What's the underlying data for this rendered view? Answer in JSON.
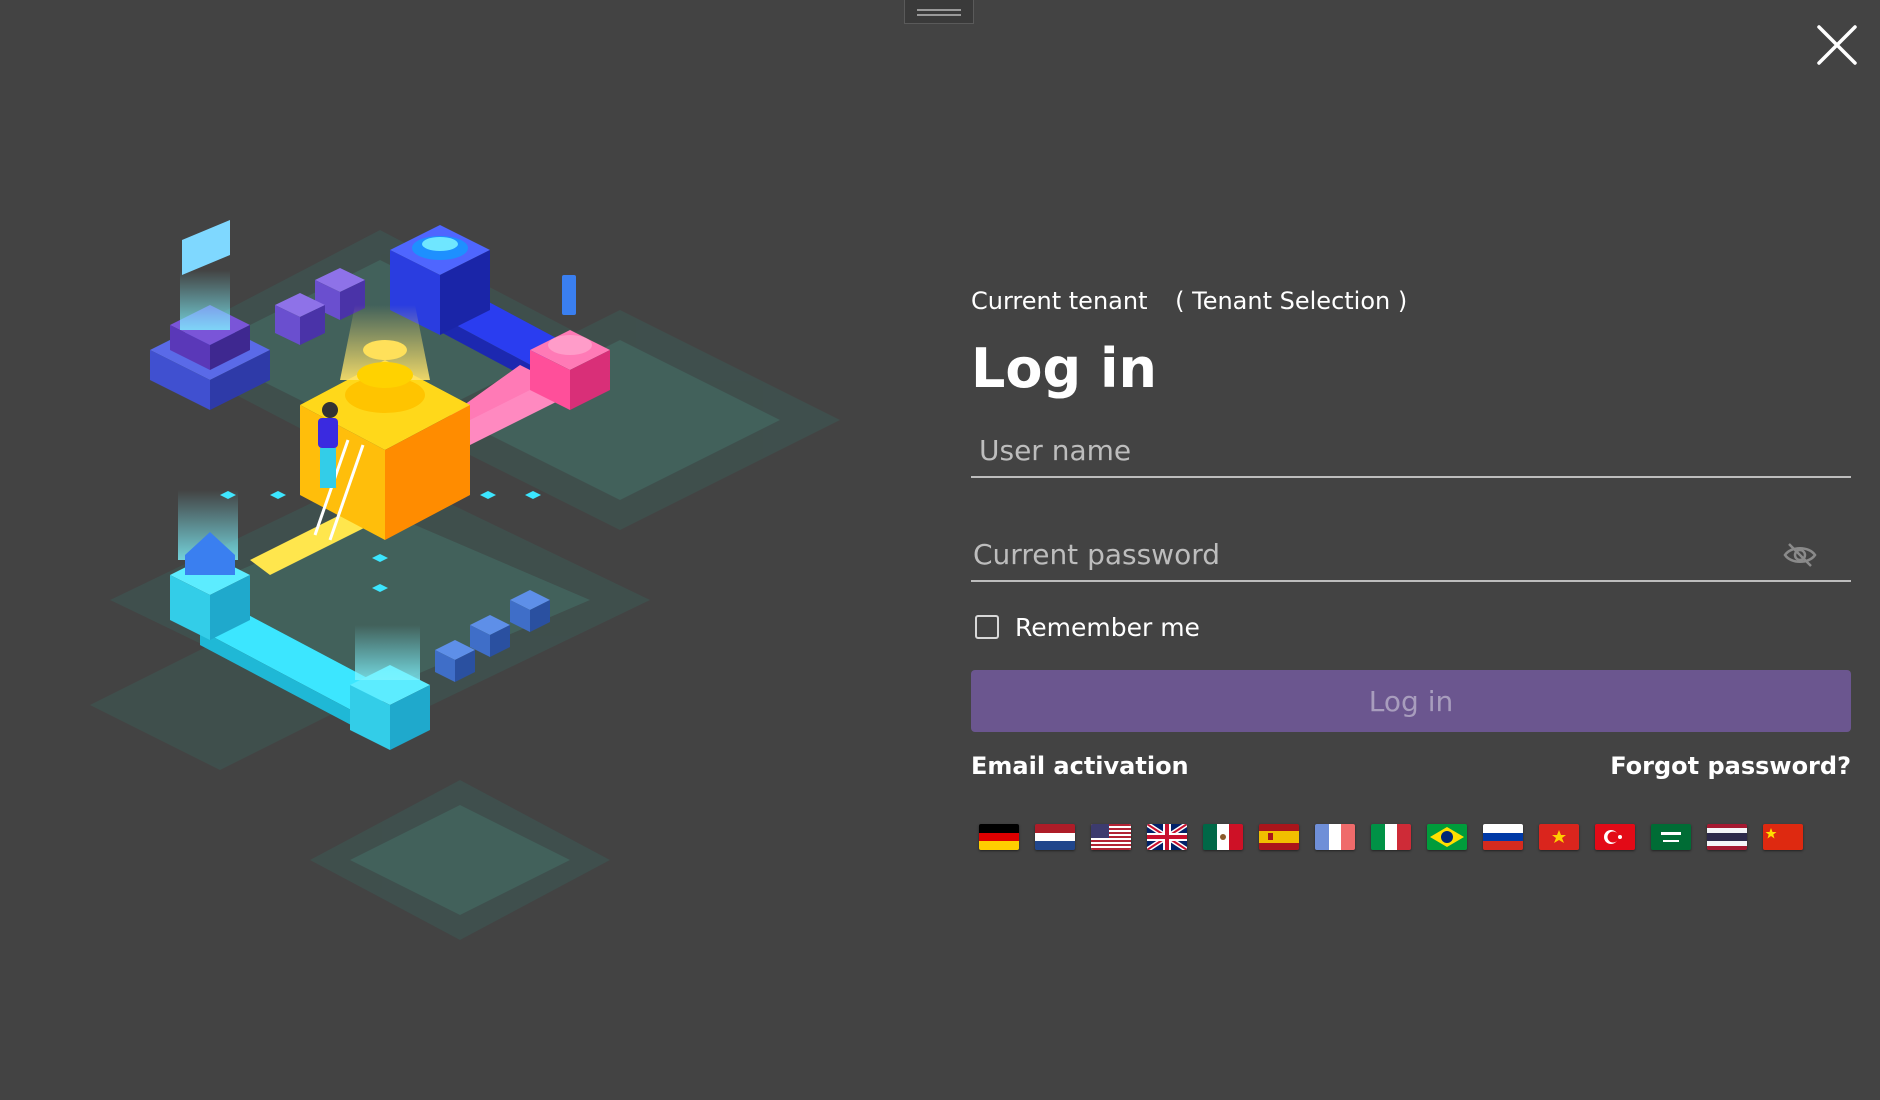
{
  "window": {
    "close_icon": "close-icon"
  },
  "tenant": {
    "label": "Current tenant",
    "selection_label": "( Tenant Selection )"
  },
  "form": {
    "title": "Log in",
    "username_placeholder": "User name",
    "password_placeholder": "Current password",
    "remember_label": "Remember me",
    "login_button": "Log in",
    "email_activation": "Email activation",
    "forgot_password": "Forgot password?"
  },
  "languages": [
    "de",
    "nl",
    "us",
    "gb",
    "mx",
    "es",
    "fr",
    "it",
    "br",
    "ru",
    "vn",
    "tr",
    "sa",
    "th",
    "cn"
  ],
  "colors": {
    "background": "#434343",
    "accent": "#6b568f"
  }
}
